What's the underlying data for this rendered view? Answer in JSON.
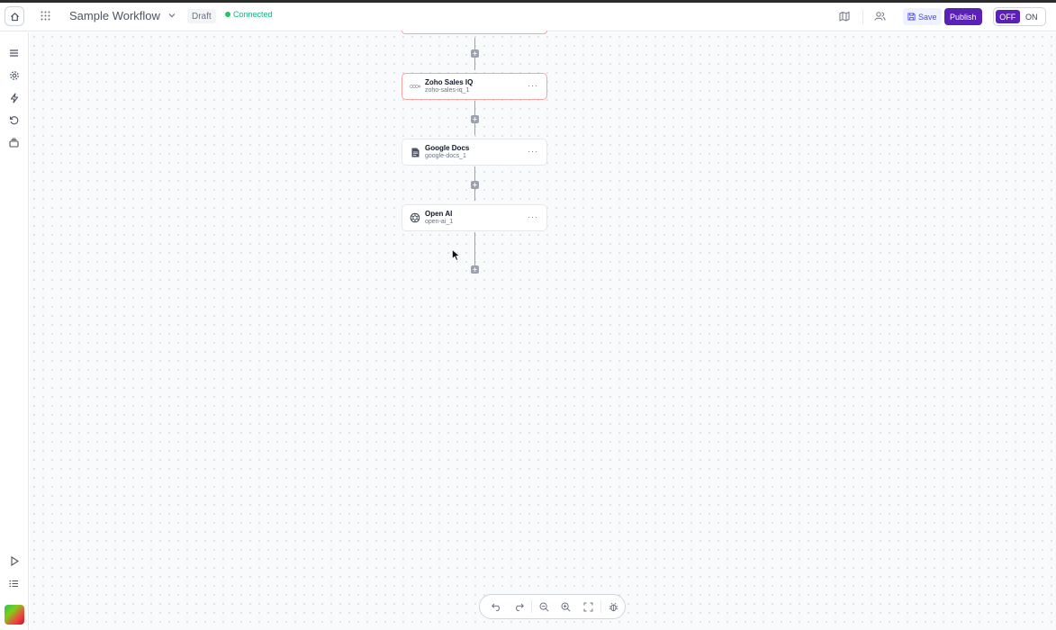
{
  "header": {
    "title": "Sample Workflow",
    "status_badge": "Draft",
    "connection_status": "Connected",
    "save_label": "Save",
    "publish_label": "Publish",
    "toggle_off_label": "OFF",
    "toggle_on_label": "ON",
    "toggle_state": "OFF"
  },
  "sidebar": {
    "items": [
      "menu-icon",
      "settings-icon",
      "bolt-icon",
      "history-icon",
      "layers-icon"
    ],
    "bottom_items": [
      "play-icon",
      "list-icon"
    ]
  },
  "nodes": [
    {
      "name": "Zoho Sales IQ",
      "id": "zoho-sales-iq_1",
      "state": "error"
    },
    {
      "name": "Google Docs",
      "id": "google-docs_1",
      "state": "normal"
    },
    {
      "name": "Open AI",
      "id": "open-ai_1",
      "state": "normal"
    }
  ],
  "toolbar": {
    "items": [
      "undo-icon",
      "redo-icon",
      "zoom-out-icon",
      "zoom-in-icon",
      "fit-view-icon",
      "debug-icon"
    ]
  },
  "colors": {
    "accent": "#5b21b6",
    "connected": "#22c55e",
    "error_border": "#f8a5a5"
  }
}
